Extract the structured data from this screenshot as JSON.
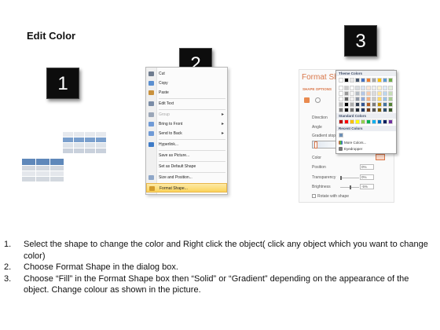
{
  "title": "Edit Color",
  "steps": [
    "1",
    "2",
    "3"
  ],
  "context_menu": {
    "items": [
      {
        "label": "Cut",
        "icon": "scissors-icon",
        "color": "#6f7c8f",
        "disabled": false,
        "submenu": false
      },
      {
        "label": "Copy",
        "icon": "copy-icon",
        "color": "#5b8fd0",
        "disabled": false,
        "submenu": false
      },
      {
        "label": "Paste",
        "icon": "paste-icon",
        "color": "#c9913c",
        "disabled": false,
        "submenu": false
      },
      {
        "label": "Edit Text",
        "icon": "edit-text-icon",
        "color": "#7a8ca6",
        "disabled": false,
        "submenu": false
      },
      {
        "label": "Group",
        "icon": "group-icon",
        "color": "#9aa6b8",
        "disabled": true,
        "submenu": true
      },
      {
        "label": "Bring to Front",
        "icon": "bring-to-front-icon",
        "color": "#6f9ad6",
        "disabled": false,
        "submenu": true
      },
      {
        "label": "Send to Back",
        "icon": "send-to-back-icon",
        "color": "#6f9ad6",
        "disabled": false,
        "submenu": true
      },
      {
        "label": "Hyperlink...",
        "icon": "hyperlink-icon",
        "color": "#3e7bc7",
        "disabled": false,
        "submenu": false
      },
      {
        "label": "Save as Picture...",
        "icon": "",
        "color": "",
        "disabled": false,
        "submenu": false
      },
      {
        "label": "Set as Default Shape",
        "icon": "",
        "color": "",
        "disabled": false,
        "submenu": false
      },
      {
        "label": "Size and Position...",
        "icon": "size-position-icon",
        "color": "#8fa7c8",
        "disabled": false,
        "submenu": false
      },
      {
        "label": "Format Shape...",
        "icon": "format-shape-icon",
        "color": "#d29b2c",
        "disabled": false,
        "submenu": false,
        "highlighted": true
      }
    ]
  },
  "format_pane": {
    "title": "Format Shape",
    "subtitle": "SHAPE OPTIONS",
    "direction": "Direction",
    "angle": "Angle",
    "gradient_stops": "Gradient stops",
    "color": "Color",
    "position": "Position",
    "position_value": "0%",
    "transparency": "Transparency",
    "transparency_value": "0%",
    "brightness": "Brightness",
    "brightness_value": "-5%",
    "rotate": "Rotate with shape"
  },
  "color_popup": {
    "theme_colors": "Theme Colors",
    "standard_colors": "Standard Colors",
    "recent_colors": "Recent Colors",
    "more_colors": "More Colors...",
    "eyedropper": "Eyedropper",
    "top_row": [
      "#ffffff",
      "#000000",
      "#e7e6e6",
      "#44546a",
      "#4472c4",
      "#ed7d31",
      "#a5a5a5",
      "#ffc000",
      "#5b9bd5",
      "#70ad47"
    ],
    "standard": [
      "#c00000",
      "#ff0000",
      "#ffc000",
      "#ffff00",
      "#92d050",
      "#00b050",
      "#00b0f0",
      "#0070c0",
      "#002060",
      "#7030a0"
    ],
    "recent": [
      "#6d8fb5"
    ]
  },
  "instructions": [
    {
      "num": "1.",
      "text": "Select the shape to change the color and Right click the object( click any object which you want to change color)"
    },
    {
      "num": "2.",
      "text": "Choose Format Shape in the dialog box."
    },
    {
      "num": "3.",
      "text": "Choose “Fill” in the Format Shape box then “Solid” or “Gradient” depending on the appearance of the object. Change colour as shown in the picture."
    }
  ]
}
